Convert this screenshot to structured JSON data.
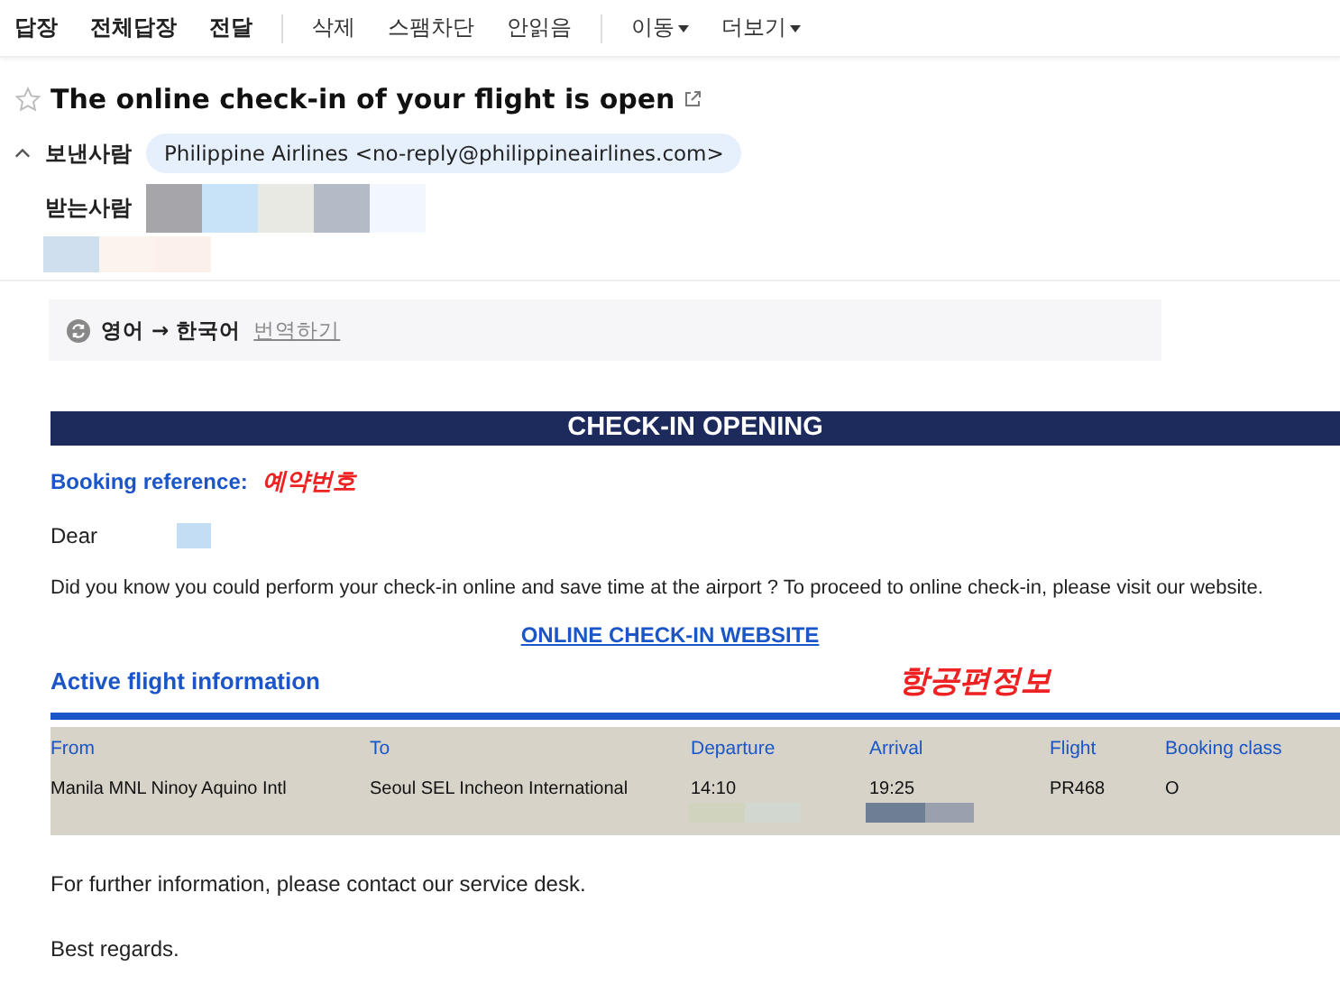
{
  "toolbar": {
    "groups": [
      {
        "kind": "bold",
        "items": [
          {
            "label": "답장"
          },
          {
            "label": "전체답장"
          },
          {
            "label": "전달"
          }
        ]
      },
      {
        "kind": "plain",
        "items": [
          {
            "label": "삭제"
          },
          {
            "label": "스팸차단"
          },
          {
            "label": "안읽음"
          }
        ]
      },
      {
        "kind": "dropdown",
        "items": [
          {
            "label": "이동"
          },
          {
            "label": "더보기"
          }
        ]
      }
    ]
  },
  "message": {
    "title": "The online check-in of your flight is open",
    "starred": false,
    "sender_label": "보낸사람",
    "sender": "Philippine Airlines <no-reply@philippineairlines.com>",
    "recipients_label": "받는사람",
    "expanded": true
  },
  "translate": {
    "from": "영어",
    "arrow": "→",
    "to": "한국어",
    "link": "번역하기"
  },
  "email": {
    "banner": "CHECK-IN OPENING",
    "booking_label": "Booking reference:",
    "booking_note": "예약번호",
    "greeting": "Dear",
    "intro": "Did you know you could perform your check-in online and save time at the airport ? To proceed to online check-in, please visit our website.",
    "link": "ONLINE CHECK-IN WEBSITE",
    "section": "Active flight information",
    "section_note": "항공편정보",
    "table": {
      "columns": [
        "From",
        "To",
        "Departure",
        "Arrival",
        "Flight",
        "Booking class"
      ],
      "rows": [
        [
          "Manila MNL Ninoy Aquino Intl",
          "Seoul SEL Incheon International",
          "14:10",
          "19:25",
          "PR468",
          "O"
        ]
      ]
    },
    "footer": "For further information, please contact our service desk.",
    "closing": "Best regards."
  }
}
